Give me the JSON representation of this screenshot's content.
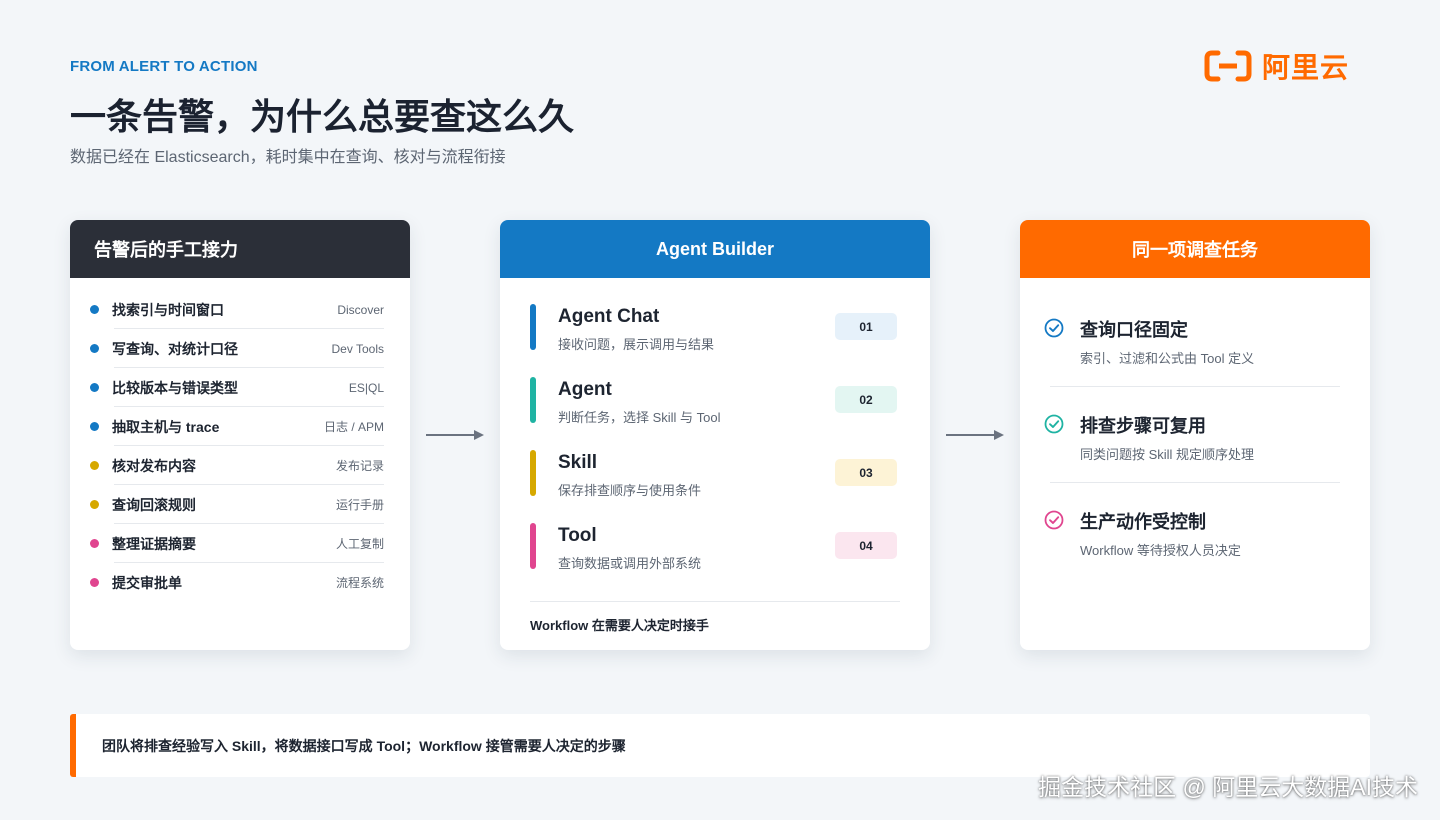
{
  "header": {
    "eyebrow": "FROM ALERT TO ACTION",
    "title": "一条告警，为什么总要查这么久",
    "subtitle": "数据已经在 Elasticsearch，耗时集中在查询、核对与流程衔接"
  },
  "logo": {
    "text": "阿里云",
    "color": "#ff6a00"
  },
  "manual": {
    "title": "告警后的手工接力",
    "items": [
      {
        "label": "找索引与时间窗口",
        "tool": "Discover",
        "color": "#1479c4"
      },
      {
        "label": "写查询、对统计口径",
        "tool": "Dev Tools",
        "color": "#1479c4"
      },
      {
        "label": "比较版本与错误类型",
        "tool": "ES|QL",
        "color": "#1479c4"
      },
      {
        "label": "抽取主机与 trace",
        "tool": "日志 / APM",
        "color": "#1479c4"
      },
      {
        "label": "核对发布内容",
        "tool": "发布记录",
        "color": "#d6a800"
      },
      {
        "label": "查询回滚规则",
        "tool": "运行手册",
        "color": "#d6a800"
      },
      {
        "label": "整理证据摘要",
        "tool": "人工复制",
        "color": "#e0458f"
      },
      {
        "label": "提交审批单",
        "tool": "流程系统",
        "color": "#e0458f"
      }
    ]
  },
  "builder": {
    "title": "Agent Builder",
    "items": [
      {
        "name": "Agent Chat",
        "desc": "接收问题，展示调用与结果",
        "badge": "01",
        "bar": "#1479c4",
        "badge_bg": "#e6f1fa"
      },
      {
        "name": "Agent",
        "desc": "判断任务，选择 Skill 与 Tool",
        "badge": "02",
        "bar": "#1fb3a3",
        "badge_bg": "#e3f6f2"
      },
      {
        "name": "Skill",
        "desc": "保存排查顺序与使用条件",
        "badge": "03",
        "bar": "#d6a800",
        "badge_bg": "#fdf3d6"
      },
      {
        "name": "Tool",
        "desc": "查询数据或调用外部系统",
        "badge": "04",
        "bar": "#e0458f",
        "badge_bg": "#fbe6ef"
      }
    ],
    "footer": "Workflow 在需要人决定时接手"
  },
  "investigation": {
    "title": "同一项调查任务",
    "items": [
      {
        "title": "查询口径固定",
        "desc": "索引、过滤和公式由 Tool 定义",
        "icon": "check-circle-icon",
        "color": "#1479c4"
      },
      {
        "title": "排查步骤可复用",
        "desc": "同类问题按 Skill 规定顺序处理",
        "icon": "check-circle-icon",
        "color": "#1fb3a3"
      },
      {
        "title": "生产动作受控制",
        "desc": "Workflow 等待授权人员决定",
        "icon": "check-circle-icon",
        "color": "#e0458f"
      }
    ]
  },
  "summary": "团队将排查经验写入 Skill，将数据接口写成 Tool；Workflow 接管需要人决定的步骤",
  "watermark": "掘金技术社区 @ 阿里云大数据AI技术"
}
